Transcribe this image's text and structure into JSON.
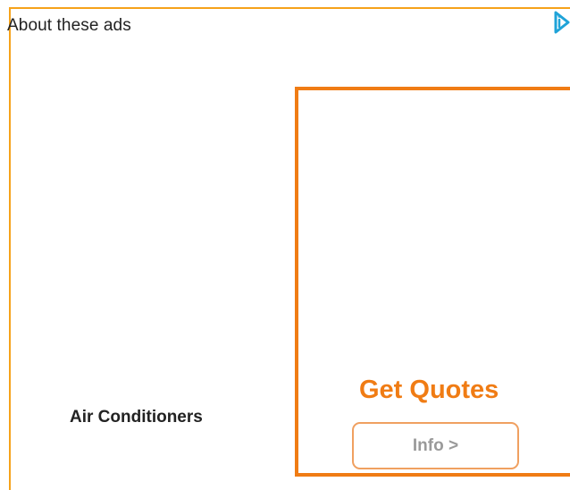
{
  "ad": {
    "about_label": "About these ads",
    "product_title": "Air Conditioners",
    "cta_heading": "Get Quotes",
    "info_button_label": "Info >",
    "adchoices_icon": "adchoices-icon"
  },
  "colors": {
    "frame_border": "#f6a21a",
    "cta_orange": "#f07c14",
    "button_border": "#f0a060",
    "button_text": "#9a9a9a",
    "adchoices_blue": "#1fa3d8"
  }
}
